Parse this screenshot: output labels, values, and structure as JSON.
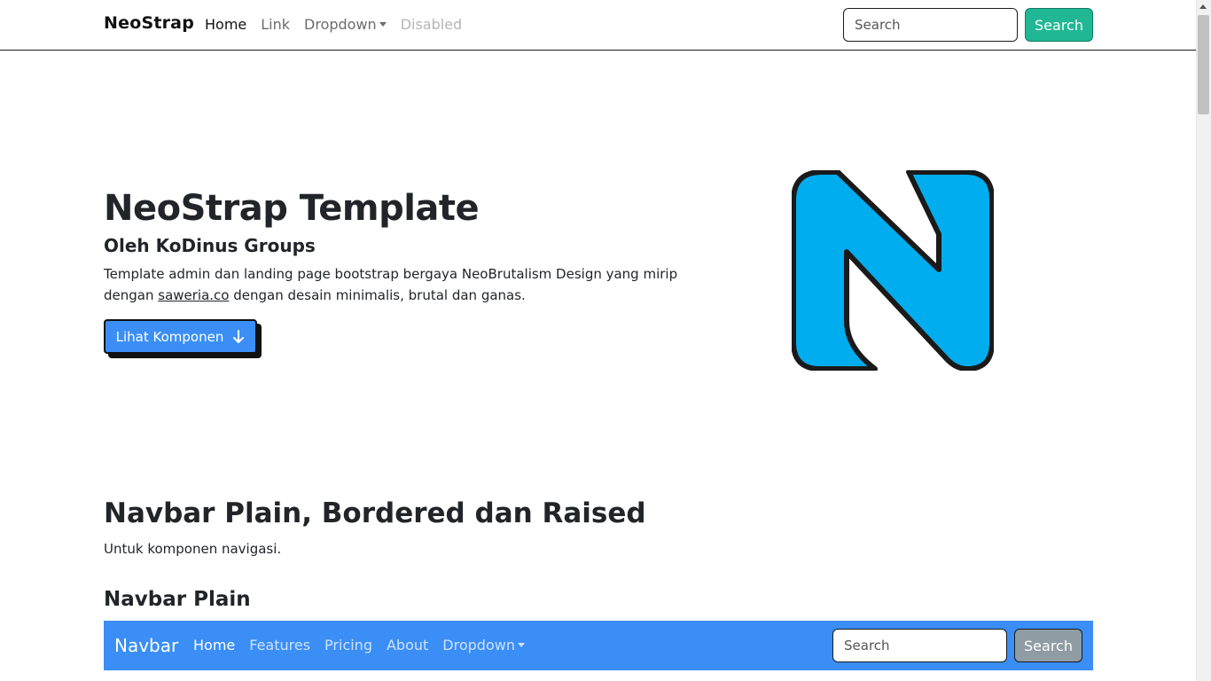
{
  "topnav": {
    "brand": "NeoStrap",
    "links": [
      "Home",
      "Link",
      "Dropdown",
      "Disabled"
    ],
    "search_placeholder": "Search",
    "search_button": "Search"
  },
  "hero": {
    "title": "NeoStrap Template",
    "subtitle": "Oleh KoDinus Groups",
    "text_before_link": "Template admin dan landing page bootstrap bergaya NeoBrutalism Design yang mirip dengan ",
    "link": "saweria.co",
    "text_after_link": " dengan desain minimalis, brutal dan ganas.",
    "button": "Lihat Komponen",
    "logo_color": "#00aeef"
  },
  "section": {
    "title": "Navbar Plain, Bordered dan Raised",
    "description": "Untuk komponen navigasi.",
    "subtitle": "Navbar Plain"
  },
  "demo_nav": {
    "brand": "Navbar",
    "links": [
      "Home",
      "Features",
      "Pricing",
      "About",
      "Dropdown"
    ],
    "search_placeholder": "Search",
    "search_button": "Search",
    "background": "#3a8ef6"
  }
}
